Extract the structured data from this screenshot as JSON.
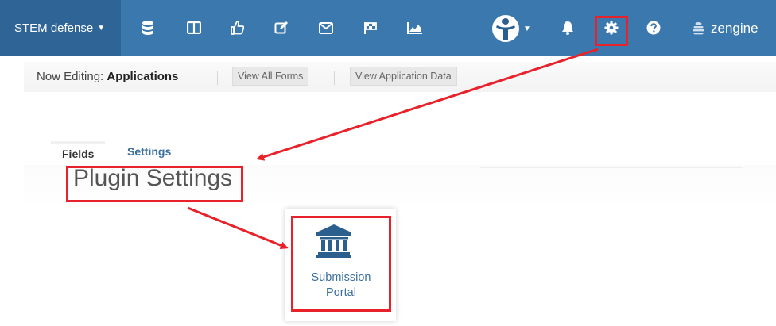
{
  "navbar": {
    "workspace_label": "STEM defense",
    "icons": [
      "database-icon",
      "columns-icon",
      "thumbs-up-icon",
      "edit-icon",
      "mail-icon",
      "flag-icon",
      "area-chart-icon",
      "avatar-icon",
      "bell-icon",
      "gear-icon",
      "help-icon",
      "zengine-logo-icon"
    ],
    "username": "zengine"
  },
  "subheader": {
    "now_editing_prefix": "Now Editing:",
    "now_editing_name": "Applications",
    "view_all_forms": "View All Forms",
    "view_application_data": "View Application Data"
  },
  "tabs": [
    {
      "label": "Fields",
      "active": true
    },
    {
      "label": "Settings",
      "active": false
    }
  ],
  "main": {
    "title": "Plugin Settings",
    "plugin": {
      "label_line1": "Submission",
      "label_line2": "Portal",
      "icon": "institution-icon"
    }
  },
  "colors": {
    "navbar": "#3a78ad",
    "workspace": "#2f6596",
    "link": "#3a6f9e",
    "annotation": "#e8222a"
  }
}
